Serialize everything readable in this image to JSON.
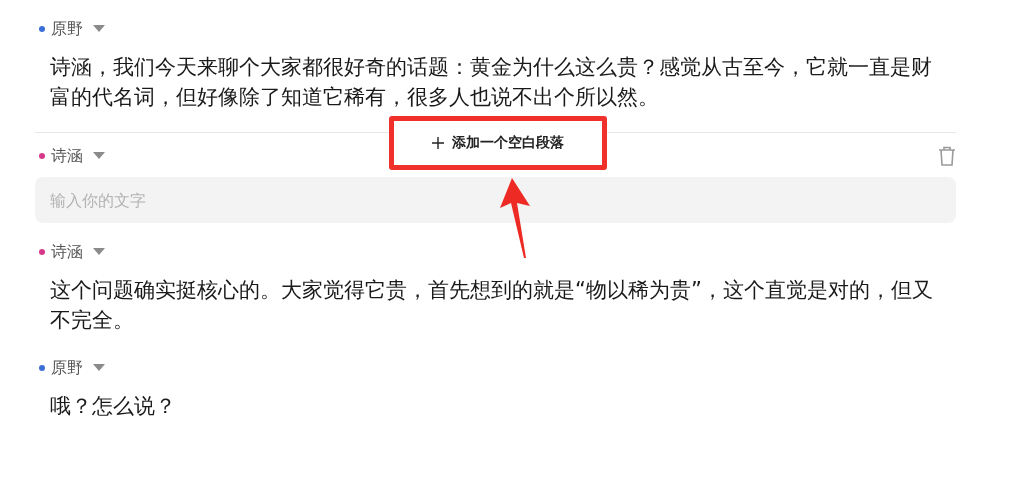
{
  "messages": [
    {
      "speaker": "原野",
      "color": "#3b6fd6",
      "kind": "text",
      "text": "诗涵，我们今天来聊个大家都很好奇的话题：黄金为什么这么贵？感觉从古至今，它就一直是财富的代名词，但好像除了知道它稀有，很多人也说不出个所以然。"
    },
    {
      "speaker": "诗涵",
      "color": "#d6398a",
      "kind": "input",
      "placeholder": "输入你的文字",
      "deletable": true
    },
    {
      "speaker": "诗涵",
      "color": "#d6398a",
      "kind": "text",
      "text": "这个问题确实挺核心的。大家觉得它贵，首先想到的就是“物以稀为贵”，这个直觉是对的，但又不完全。"
    },
    {
      "speaker": "原野",
      "color": "#3b6fd6",
      "kind": "text",
      "text": "哦？怎么说？"
    }
  ],
  "add_paragraph_button": {
    "label": "添加一个空白段落"
  }
}
